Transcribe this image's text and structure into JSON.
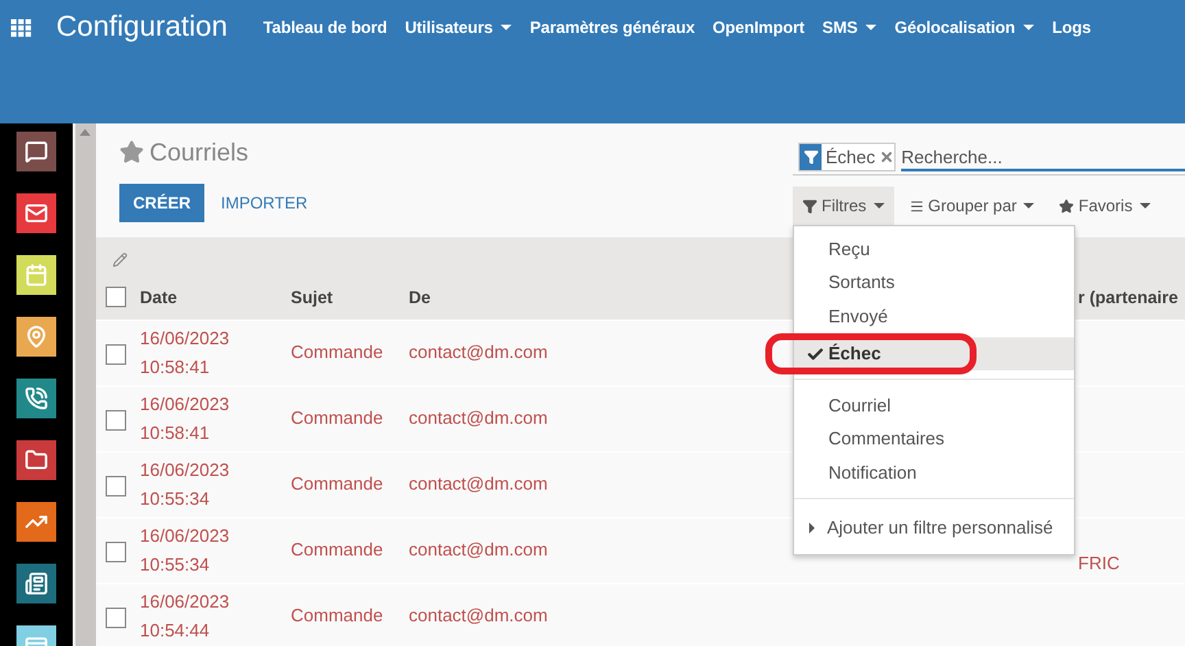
{
  "app_title": "Configuration",
  "top_menu": [
    {
      "label": "Tableau de bord",
      "has_menu": false
    },
    {
      "label": "Utilisateurs",
      "has_menu": true
    },
    {
      "label": "Paramètres généraux",
      "has_menu": false
    },
    {
      "label": "OpenImport",
      "has_menu": false
    },
    {
      "label": "SMS",
      "has_menu": true
    },
    {
      "label": "Géolocalisation",
      "has_menu": true
    },
    {
      "label": "Logs",
      "has_menu": false
    }
  ],
  "sidebar": {
    "apps": [
      {
        "color": "#7a4d4a"
      },
      {
        "color": "#e73a3f"
      },
      {
        "color": "#d3db5b"
      },
      {
        "color": "#e9a850"
      },
      {
        "color": "#22898a"
      },
      {
        "color": "#c93a3c"
      },
      {
        "color": "#e3691b"
      },
      {
        "color": "#1d6d7e"
      },
      {
        "color": "#80cfe2"
      }
    ]
  },
  "breadcrumb": {
    "title": "Courriels",
    "favorite": false
  },
  "buttons": {
    "create": "CRÉER",
    "import": "IMPORTER"
  },
  "search": {
    "facets": [
      {
        "label": "Échec"
      }
    ],
    "placeholder": "Recherche..."
  },
  "search_buttons": [
    {
      "label": "Filtres",
      "open": true
    },
    {
      "label": "Grouper par",
      "open": false
    },
    {
      "label": "Favoris",
      "open": false
    }
  ],
  "filter_menu": {
    "groups": [
      {
        "items": [
          {
            "label": "Reçu",
            "checked": false,
            "highlighted": false
          },
          {
            "label": "Sortants",
            "checked": false,
            "highlighted": false
          },
          {
            "label": "Envoyé",
            "checked": false,
            "highlighted": false
          },
          {
            "label": "Échec",
            "checked": true,
            "highlighted": true
          }
        ]
      },
      {
        "items": [
          {
            "label": "Courriel",
            "checked": false,
            "highlighted": false
          },
          {
            "label": "Commentaires",
            "checked": false,
            "highlighted": false
          },
          {
            "label": "Notification",
            "checked": false,
            "highlighted": false
          }
        ]
      }
    ],
    "custom_filter": "Ajouter un filtre personnalisé"
  },
  "table": {
    "all_selected": false,
    "columns": [
      "Date",
      "Sujet",
      "De",
      "r (partenaire"
    ],
    "rows": [
      {
        "date": "16/06/2023",
        "time": "10:58:41",
        "subject": "Commande",
        "from": "contact@dm.com",
        "column_4": "",
        "checked": false
      },
      {
        "date": "16/06/2023",
        "time": "10:58:41",
        "subject": "Commande",
        "from": "contact@dm.com",
        "column_4": "",
        "checked": false
      },
      {
        "date": "16/06/2023",
        "time": "10:55:34",
        "subject": "Commande",
        "from": "contact@dm.com",
        "column_4": "",
        "checked": false
      },
      {
        "date": "16/06/2023",
        "time": "10:55:34",
        "subject": "Commande",
        "from": "contact@dm.com",
        "column_4": "FRIC",
        "checked": false
      },
      {
        "date": "16/06/2023",
        "time": "10:54:44",
        "subject": "Commande",
        "from": "contact@dm.com",
        "column_4": "",
        "checked": false
      }
    ]
  }
}
